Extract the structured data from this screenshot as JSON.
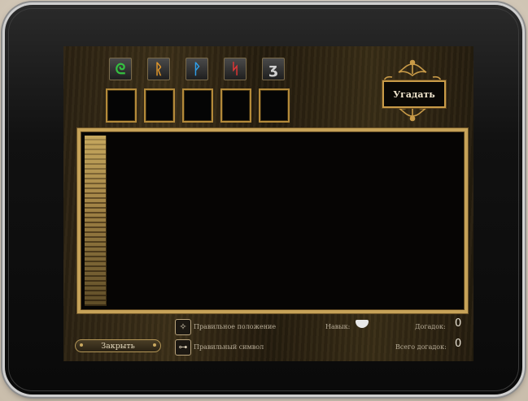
{
  "glyphs": [
    {
      "name": "green-rune-icon",
      "symbol": "ᘓ",
      "color": "#35c040"
    },
    {
      "name": "orange-rune-icon",
      "symbol": "ᚱ",
      "color": "#e0962a"
    },
    {
      "name": "blue-rune-icon",
      "symbol": "ᚹ",
      "color": "#2f9ee8"
    },
    {
      "name": "red-rune-icon",
      "symbol": "ᛋ",
      "color": "#e23535"
    },
    {
      "name": "gray-rune-icon",
      "symbol": "ʒ",
      "color": "#cfcfcf"
    }
  ],
  "guess_button": {
    "label": "Угадать"
  },
  "legend": {
    "position_label": "Правильное положение",
    "symbol_label": "Правильный символ"
  },
  "skill": {
    "label": "Навык:"
  },
  "stats": {
    "guesses_label": "Догадок:",
    "guesses_value": "0",
    "total_label": "Всего догадок:",
    "total_value": "0"
  },
  "close_button": {
    "label": "Закрыть"
  }
}
